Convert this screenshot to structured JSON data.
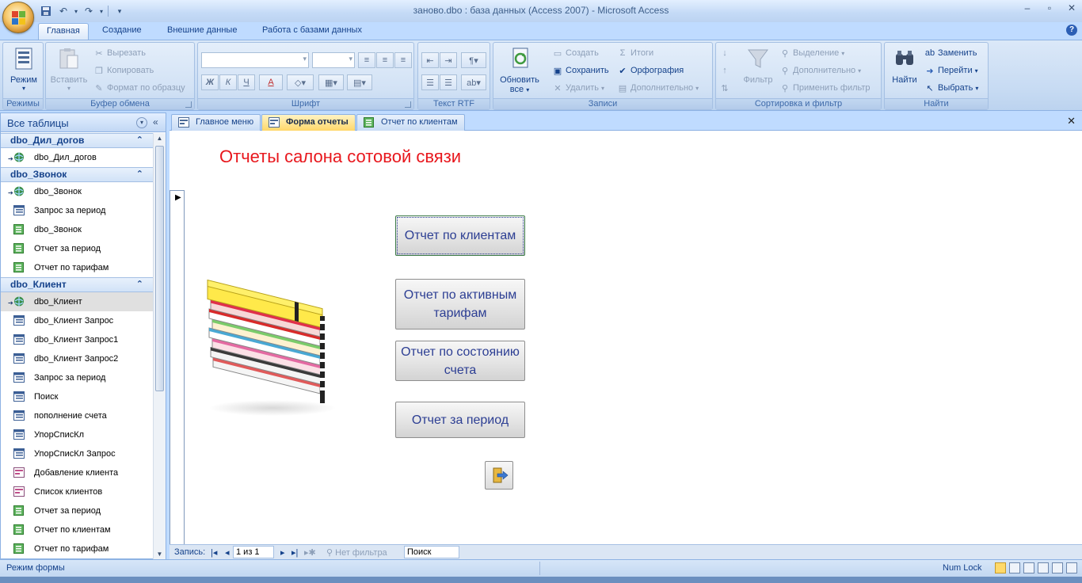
{
  "window": {
    "title": "заново.dbo : база данных (Access 2007) - Microsoft Access"
  },
  "ribbon": {
    "tabs": [
      "Главная",
      "Создание",
      "Внешние данные",
      "Работа с базами данных"
    ],
    "groups": {
      "modes": {
        "label": "Режимы",
        "mode_button": "Режим"
      },
      "clipboard": {
        "label": "Буфер обмена",
        "paste": "Вставить",
        "cut": "Вырезать",
        "copy": "Копировать",
        "format_painter": "Формат по образцу"
      },
      "font": {
        "label": "Шрифт",
        "bold": "Ж",
        "italic": "К",
        "underline": "Ч",
        "font_color": "A"
      },
      "rtf": {
        "label": "Текст RTF"
      },
      "records": {
        "label": "Записи",
        "refresh": "Обновить",
        "refresh_all": "все",
        "create": "Создать",
        "save": "Сохранить",
        "delete": "Удалить",
        "totals": "Итоги",
        "spelling": "Орфография",
        "more": "Дополнительно"
      },
      "sort_filter": {
        "label": "Сортировка и фильтр",
        "filter": "Фильтр",
        "selection": "Выделение",
        "advanced": "Дополнительно",
        "apply_filter": "Применить фильтр"
      },
      "find": {
        "label": "Найти",
        "find": "Найти",
        "replace": "Заменить",
        "goto": "Перейти",
        "select": "Выбрать"
      }
    }
  },
  "nav": {
    "header": "Все таблицы",
    "groups": [
      {
        "name": "dbo_Дил_догов",
        "items": [
          {
            "label": "dbo_Дил_догов",
            "type": "linked-table"
          }
        ]
      },
      {
        "name": "dbo_Звонок",
        "items": [
          {
            "label": "dbo_Звонок",
            "type": "linked-table"
          },
          {
            "label": "Запрос за период",
            "type": "query"
          },
          {
            "label": "dbo_Звонок",
            "type": "report"
          },
          {
            "label": "Отчет за период",
            "type": "report"
          },
          {
            "label": "Отчет по тарифам",
            "type": "report"
          }
        ]
      },
      {
        "name": "dbo_Клиент",
        "items": [
          {
            "label": "dbo_Клиент",
            "type": "linked-table"
          },
          {
            "label": "dbo_Клиент Запрос",
            "type": "query"
          },
          {
            "label": "dbo_Клиент Запрос1",
            "type": "query"
          },
          {
            "label": "dbo_Клиент Запрос2",
            "type": "query"
          },
          {
            "label": "Запрос за период",
            "type": "query"
          },
          {
            "label": "Поиск",
            "type": "query"
          },
          {
            "label": "пополнение счета",
            "type": "query"
          },
          {
            "label": "УпорСписКл",
            "type": "query"
          },
          {
            "label": "УпорСписКл Запрос",
            "type": "query"
          },
          {
            "label": "Добавление клиента",
            "type": "form"
          },
          {
            "label": "Список клиентов",
            "type": "form"
          },
          {
            "label": "Отчет за период",
            "type": "report"
          },
          {
            "label": "Отчет по клиентам",
            "type": "report"
          },
          {
            "label": "Отчет по тарифам",
            "type": "report"
          }
        ]
      }
    ]
  },
  "doc_tabs": [
    {
      "label": "Главное меню",
      "type": "form"
    },
    {
      "label": "Форма отчеты",
      "type": "form"
    },
    {
      "label": "Отчет по клиентам",
      "type": "report"
    }
  ],
  "form": {
    "title": "Отчеты салона сотовой связи",
    "buttons": [
      "Отчет по клиентам",
      "Отчет по активным тарифам",
      "Отчет по состоянию счета",
      "Отчет за период"
    ]
  },
  "record_bar": {
    "label": "Запись:",
    "position": "1 из 1",
    "filter": "Нет фильтра",
    "search": "Поиск"
  },
  "status": {
    "mode": "Режим формы",
    "num_lock": "Num Lock"
  },
  "colors": {
    "form_title": "#e8171d",
    "button_text": "#2c3e93",
    "active_tab": "#ffd76a"
  }
}
